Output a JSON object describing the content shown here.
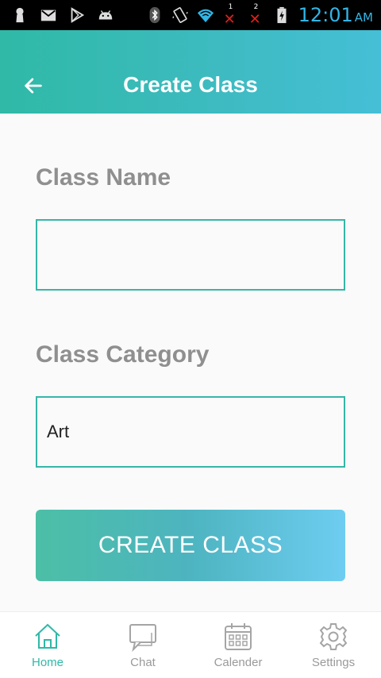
{
  "status_bar": {
    "sim1_label": "1",
    "sim2_label": "2",
    "time": "12:01",
    "ampm": "AM"
  },
  "app_bar": {
    "title": "Create Class"
  },
  "form": {
    "class_name_label": "Class Name",
    "class_name_value": "",
    "class_category_label": "Class Category",
    "class_category_value": "Art",
    "create_button_label": "CREATE CLASS"
  },
  "bottom_nav": {
    "items": [
      {
        "label": "Home",
        "icon": "home-icon",
        "active": true
      },
      {
        "label": "Chat",
        "icon": "chat-icon",
        "active": false
      },
      {
        "label": "Calender",
        "icon": "calendar-icon",
        "active": false
      },
      {
        "label": "Settings",
        "icon": "gear-icon",
        "active": false
      }
    ]
  },
  "colors": {
    "accent": "#2fb9a6",
    "status_clock": "#33b5e5",
    "label_gray": "#8f8f8f"
  }
}
